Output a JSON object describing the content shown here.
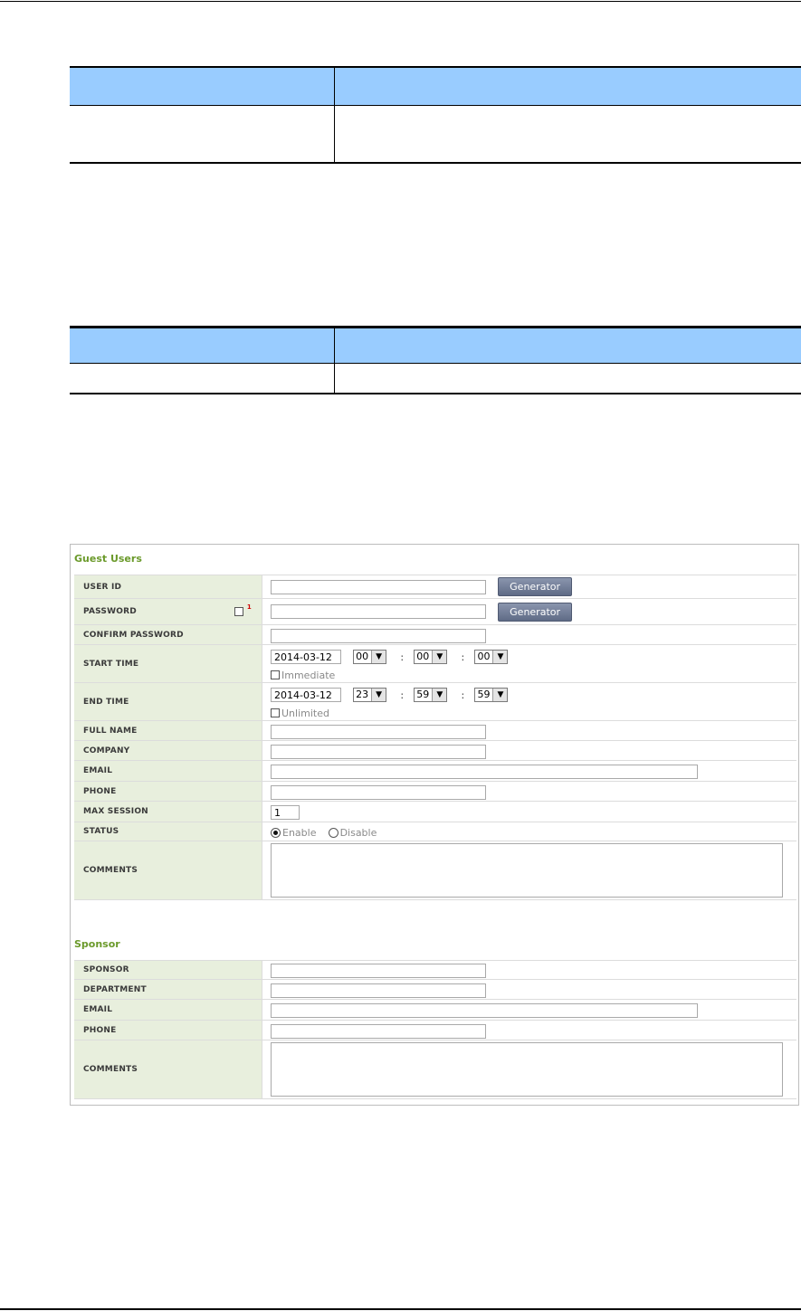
{
  "guest_section": {
    "title": "Guest Users",
    "user_id": {
      "label": "USER ID",
      "value": "",
      "button": "Generator"
    },
    "password": {
      "label": "PASSWORD",
      "value": "",
      "button": "Generator",
      "note_marker": "1"
    },
    "confirm_password": {
      "label": "CONFIRM PASSWORD",
      "value": ""
    },
    "start_time": {
      "label": "START TIME",
      "date": "2014-03-12",
      "hour": "00",
      "minute": "00",
      "second": "00",
      "option_label": "Immediate",
      "option_checked": false
    },
    "end_time": {
      "label": "END TIME",
      "date": "2014-03-12",
      "hour": "23",
      "minute": "59",
      "second": "59",
      "option_label": "Unlimited",
      "option_checked": false
    },
    "full_name": {
      "label": "FULL NAME",
      "value": ""
    },
    "company": {
      "label": "COMPANY",
      "value": ""
    },
    "email": {
      "label": "EMAIL",
      "value": ""
    },
    "phone": {
      "label": "PHONE",
      "value": ""
    },
    "max_session": {
      "label": "MAX SESSION",
      "value": "1"
    },
    "status": {
      "label": "STATUS",
      "enable_label": "Enable",
      "disable_label": "Disable",
      "selected": "Enable"
    },
    "comments": {
      "label": "COMMENTS",
      "value": ""
    }
  },
  "sponsor_section": {
    "title": "Sponsor",
    "sponsor": {
      "label": "SPONSOR",
      "value": ""
    },
    "department": {
      "label": "DEPARTMENT",
      "value": ""
    },
    "email": {
      "label": "EMAIL",
      "value": ""
    },
    "phone": {
      "label": "PHONE",
      "value": ""
    },
    "comments": {
      "label": "COMMENTS",
      "value": ""
    }
  },
  "colors": {
    "section_title": "#6b9a2b",
    "label_bg": "#e8efdd",
    "table_header": "#99ccff",
    "button": "#6f7a94"
  }
}
